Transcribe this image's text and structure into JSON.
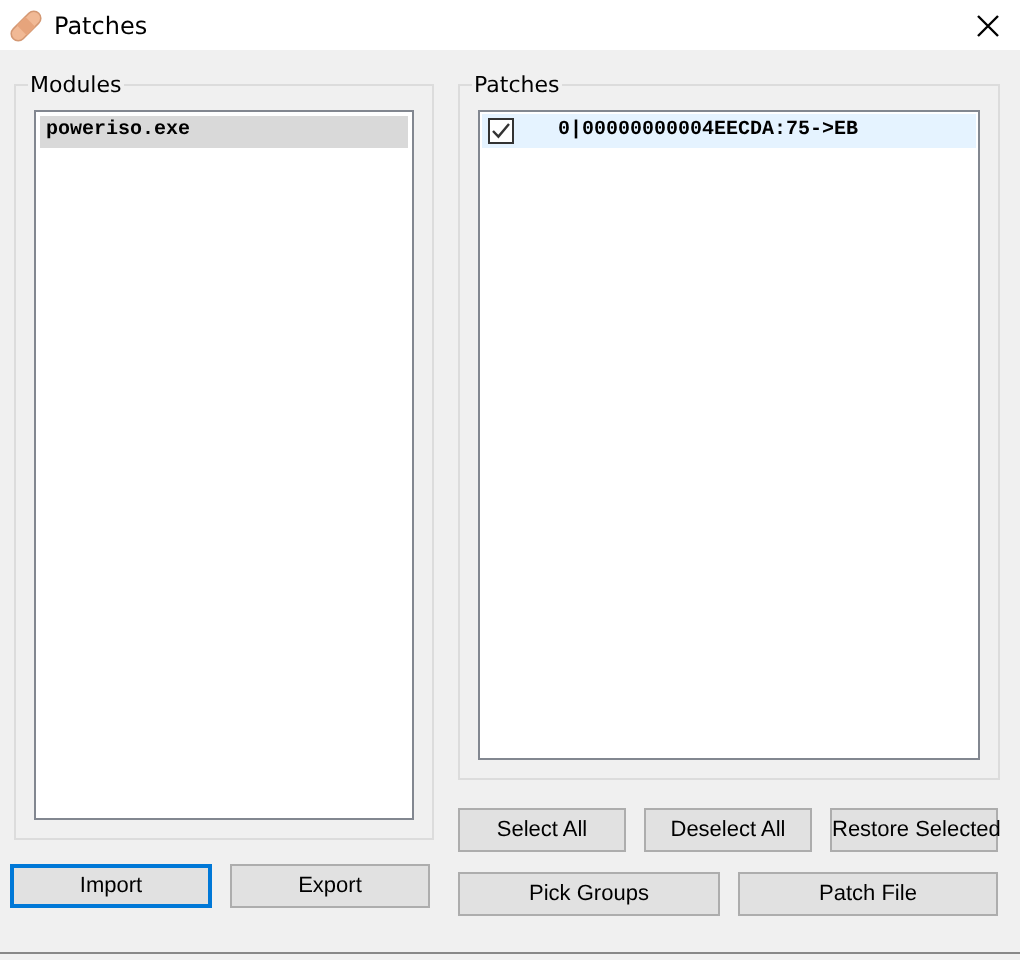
{
  "window": {
    "title": "Patches"
  },
  "modules": {
    "label": "Modules",
    "items": [
      {
        "name": "poweriso.exe",
        "selected": true
      }
    ]
  },
  "patches": {
    "label": "Patches",
    "items": [
      {
        "text": "0|00000000004EECDA:75->EB",
        "checked": true,
        "selected": true
      }
    ]
  },
  "module_buttons": [
    {
      "label": "Import",
      "focused": true
    },
    {
      "label": "Export",
      "focused": false
    }
  ],
  "patch_buttons": [
    {
      "label": "Select All",
      "focused": false
    },
    {
      "label": "Deselect All",
      "focused": false
    },
    {
      "label": "Restore Selected",
      "focused": false
    }
  ],
  "file_buttons": [
    {
      "label": "Pick Groups",
      "focused": false
    },
    {
      "label": "Patch File",
      "focused": false
    }
  ]
}
